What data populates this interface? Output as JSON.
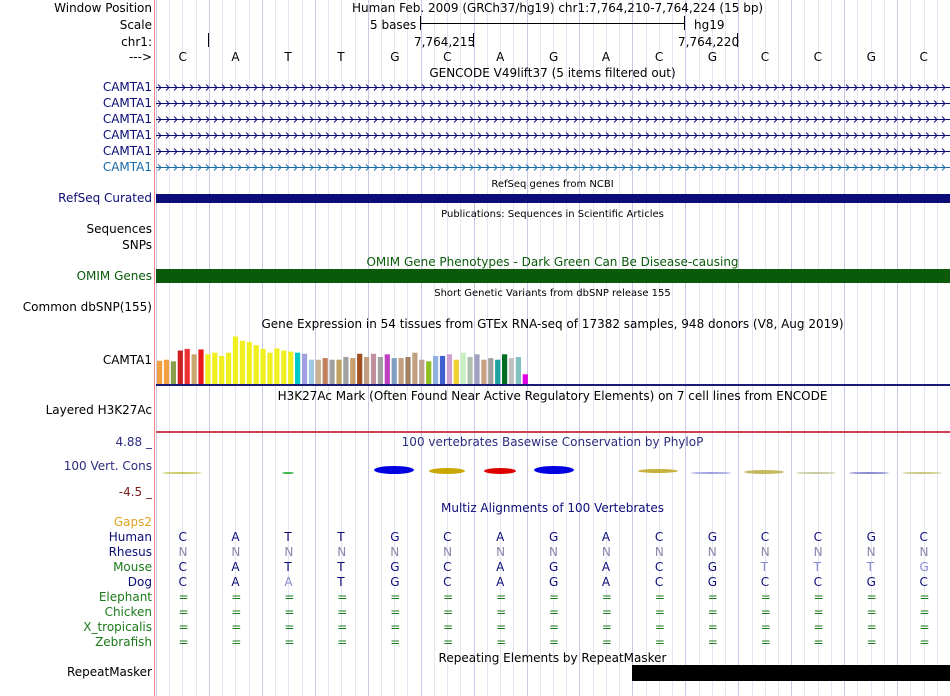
{
  "header": {
    "window_position_label": "Window Position",
    "window_position_value": "Human Feb. 2009 (GRCh37/hg19)   chr1:7,764,210-7,764,224 (15 bp)",
    "scale_label": "Scale",
    "scale_bases": "5 bases",
    "scale_assembly": "hg19",
    "chrom_label": "chr1:",
    "coord_1": "7,764,215",
    "coord_2": "7,764,220",
    "arrow_label": "--->",
    "bases": [
      "C",
      "A",
      "T",
      "T",
      "G",
      "C",
      "A",
      "G",
      "A",
      "C",
      "G",
      "C",
      "C",
      "G",
      "C"
    ]
  },
  "gencode": {
    "title": "GENCODE V49lift37 (5 items filtered out)",
    "items": [
      "CAMTA1",
      "CAMTA1",
      "CAMTA1",
      "CAMTA1",
      "CAMTA1",
      "CAMTA1"
    ],
    "colors": [
      "#0c0c78",
      "#0c0c78",
      "#0c0c78",
      "#0c0c78",
      "#0c0c78",
      "#1a6aa8"
    ]
  },
  "refseq": {
    "title": "RefSeq genes from NCBI",
    "label": "RefSeq Curated",
    "color": "#0c0c78"
  },
  "publications": {
    "title": "Publications: Sequences in Scientific Articles",
    "label_1": "Sequences",
    "label_2": "SNPs"
  },
  "omim": {
    "title": "OMIM Gene Phenotypes - Dark Green Can Be Disease-causing",
    "label": "OMIM Genes",
    "color": "#0a5a0a"
  },
  "dbsnp": {
    "title": "Short Genetic Variants from dbSNP release 155",
    "label": "Common dbSNP(155)"
  },
  "gtex": {
    "title": "Gene Expression in 54 tissues from GTEx RNA-seq of 17382 samples, 948 donors (V8, Aug 2019)",
    "label": "CAMTA1",
    "levels": [
      0.43,
      0.45,
      0.42,
      0.62,
      0.65,
      0.55,
      0.64,
      0.55,
      0.58,
      0.52,
      0.58,
      0.88,
      0.8,
      0.78,
      0.72,
      0.65,
      0.58,
      0.66,
      0.62,
      0.6,
      0.58,
      0.56,
      0.45,
      0.45,
      0.48,
      0.45,
      0.45,
      0.5,
      0.48,
      0.56,
      0.5,
      0.56,
      0.5,
      0.55,
      0.48,
      0.48,
      0.5,
      0.58,
      0.45,
      0.42,
      0.52,
      0.52,
      0.55,
      0.45,
      0.58,
      0.5,
      0.55,
      0.45,
      0.48,
      0.45,
      0.55,
      0.48,
      0.5,
      0.18
    ],
    "bar_colors": [
      "#f5a040",
      "#f5a040",
      "#8aa050",
      "#cc2020",
      "#ee3030",
      "#c8a870",
      "#e81818",
      "#f0f020",
      "#f0f020",
      "#f0f020",
      "#f0f020",
      "#f0f020",
      "#f0f020",
      "#f0f020",
      "#f0f020",
      "#f0f020",
      "#f0f020",
      "#f0f020",
      "#f0f020",
      "#f0f020",
      "#00c8c8",
      "#a0a0e0",
      "#a0c8e0",
      "#c8b090",
      "#c08060",
      "#a0a0a0",
      "#c0a060",
      "#a0a0a0",
      "#c8a070",
      "#a05020",
      "#c0a080",
      "#c090a0",
      "#a0a0a0",
      "#c040c0",
      "#80a0c0",
      "#c0a080",
      "#a08060",
      "#c0a080",
      "#c0a090",
      "#90c020",
      "#90b0e0",
      "#4060d0",
      "#d0a0d0",
      "#f0d030",
      "#c8f0c0",
      "#b0c0b0",
      "#a0a0c0",
      "#c8a080",
      "#a0a0a0",
      "#20a0a0",
      "#007020",
      "#c0c0c0",
      "#80c0c0",
      "#e000e0"
    ]
  },
  "h3k27ac": {
    "title": "H3K27Ac Mark (Often Found Near Active Regulatory Elements) on 7 cell lines from ENCODE",
    "label": "Layered H3K27Ac"
  },
  "phylop": {
    "title": "100 vertebrates Basewise Conservation by PhyloP",
    "label": "100 Vert. Cons",
    "max": "4.88 _",
    "min": "-4.5 _"
  },
  "multiz": {
    "title": "Multiz Alignments of 100 Vertebrates",
    "gaps_label": "Gaps2",
    "species": [
      {
        "name": "Human",
        "seq": [
          "C",
          "A",
          "T",
          "T",
          "G",
          "C",
          "A",
          "G",
          "A",
          "C",
          "G",
          "C",
          "C",
          "G",
          "C"
        ]
      },
      {
        "name": "Rhesus",
        "seq": [
          "N",
          "N",
          "N",
          "N",
          "N",
          "N",
          "N",
          "N",
          "N",
          "N",
          "N",
          "N",
          "N",
          "N",
          "N"
        ]
      },
      {
        "name": "Mouse",
        "seq": [
          "C",
          "A",
          "T",
          "T",
          "G",
          "C",
          "A",
          "G",
          "A",
          "C",
          "G",
          "T",
          "T",
          "T",
          "G"
        ]
      },
      {
        "name": "Dog",
        "seq": [
          "C",
          "A",
          "A",
          "T",
          "G",
          "C",
          "A",
          "G",
          "A",
          "C",
          "G",
          "C",
          "C",
          "G",
          "C"
        ]
      },
      {
        "name": "Elephant",
        "seq": [
          "=",
          "=",
          "=",
          "=",
          "=",
          "=",
          "=",
          "=",
          "=",
          "=",
          "=",
          "=",
          "=",
          "=",
          "="
        ]
      },
      {
        "name": "Chicken",
        "seq": [
          "=",
          "=",
          "=",
          "=",
          "=",
          "=",
          "=",
          "=",
          "=",
          "=",
          "=",
          "=",
          "=",
          "=",
          "="
        ]
      },
      {
        "name": "X_tropicalis",
        "seq": [
          "=",
          "=",
          "=",
          "=",
          "=",
          "=",
          "=",
          "=",
          "=",
          "=",
          "=",
          "=",
          "=",
          "=",
          "="
        ]
      },
      {
        "name": "Zebrafish",
        "seq": [
          "=",
          "=",
          "=",
          "=",
          "=",
          "=",
          "=",
          "=",
          "=",
          "=",
          "=",
          "=",
          "=",
          "=",
          "="
        ]
      }
    ]
  },
  "repeatmasker": {
    "title": "Repeating Elements by RepeatMasker",
    "label": "RepeatMasker"
  }
}
